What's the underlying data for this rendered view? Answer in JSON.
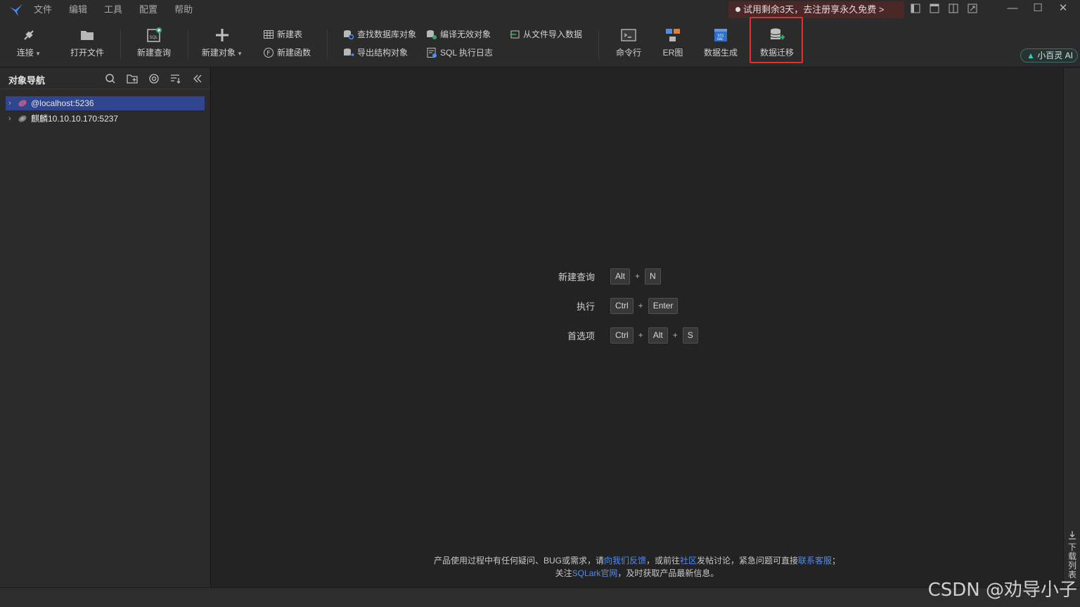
{
  "menu": [
    "文件",
    "编辑",
    "工具",
    "配置",
    "帮助"
  ],
  "trial_banner": "试用剩余3天，去注册享永久免费 >",
  "window_controls": {
    "minimize": "—",
    "maximize": "☐",
    "close": "✕"
  },
  "toolbar": {
    "connect": "连接",
    "open_file": "打开文件",
    "new_query": "新建查询",
    "new_object": "新建对象",
    "new_table": "新建表",
    "new_function": "新建函数",
    "find_db_object": "查找数据库对象",
    "compile_invalid": "编译无效对象",
    "export_structure": "导出结构对象",
    "sql_log": "SQL 执行日志",
    "import_from_file": "从文件导入数据",
    "command_line": "命令行",
    "er_diagram": "ER图",
    "data_generate": "数据生成",
    "data_migrate": "数据迁移",
    "ai_button": "小百灵 AI"
  },
  "sidebar": {
    "title": "对象导航",
    "connections": [
      {
        "label": "@localhost:5236",
        "selected": true
      },
      {
        "label": "麒麟10.10.10.170:5237",
        "selected": false
      }
    ]
  },
  "shortcuts": [
    {
      "label": "新建查询",
      "keys": [
        "Alt",
        "N"
      ]
    },
    {
      "label": "执行",
      "keys": [
        "Ctrl",
        "Enter"
      ]
    },
    {
      "label": "首选项",
      "keys": [
        "Ctrl",
        "Alt",
        "S"
      ]
    }
  ],
  "footer": {
    "line1_a": "产品使用过程中有任何疑问、BUG或需求，请",
    "line1_link1": "向我们反馈",
    "line1_b": "，或前往",
    "line1_link2": "社区",
    "line1_c": "发帖讨论，紧急问题可直接",
    "line1_link3": "联系客服",
    "line1_d": "；",
    "line2_a": "关注",
    "line2_link": "SQLark官网",
    "line2_b": "，及时获取产品最新信息。"
  },
  "right_panel": {
    "download_list": "下载列表"
  },
  "watermark": "CSDN @劝导小子",
  "colors": {
    "accent_blue": "#2f4590",
    "highlight_red": "#e0322d",
    "link": "#4f8cf0"
  }
}
